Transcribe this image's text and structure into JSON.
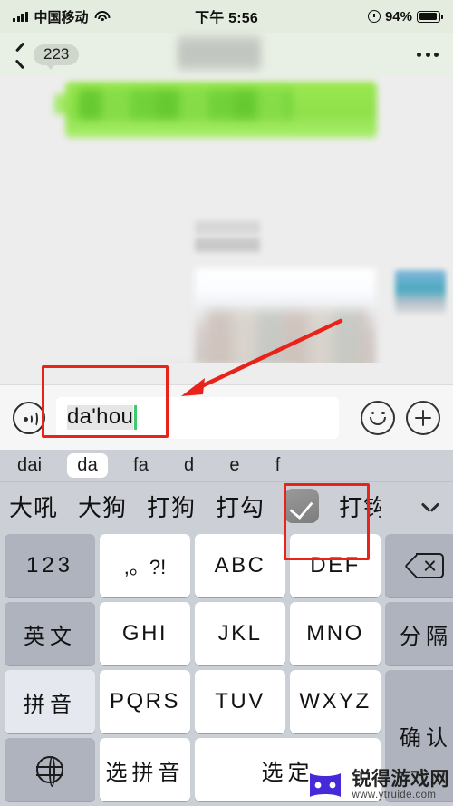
{
  "status_bar": {
    "signal_icon": "signal-bars-icon",
    "carrier": "中国移动",
    "wifi_icon": "wifi-icon",
    "time": "下午 5:56",
    "alarm_icon": "alarm-clock-icon",
    "battery_percent": "94%",
    "battery_icon": "battery-icon"
  },
  "nav_bar": {
    "back_icon": "back-chevron-icon",
    "unread_count": "223",
    "title": "",
    "more_icon": "more-dots-icon"
  },
  "chat": {
    "messages_blurred": true
  },
  "input_bar": {
    "voice_icon": "voice-input-icon",
    "composing_text": "da'hou",
    "placeholder": "",
    "emoji_icon": "smiley-face-icon",
    "plus_icon": "plus-circle-icon"
  },
  "ime": {
    "syllables": [
      {
        "label": "dai",
        "active": false
      },
      {
        "label": "da",
        "active": true
      },
      {
        "label": "fa",
        "active": false
      },
      {
        "label": "d",
        "active": false
      },
      {
        "label": "e",
        "active": false
      },
      {
        "label": "f",
        "active": false
      }
    ],
    "candidates": [
      {
        "label": "大吼",
        "type": "text"
      },
      {
        "label": "大狗",
        "type": "text"
      },
      {
        "label": "打狗",
        "type": "text"
      },
      {
        "label": "打勾",
        "type": "text"
      },
      {
        "label": "☑",
        "type": "emoji",
        "name": "check-box-emoji"
      },
      {
        "label": "打钩",
        "type": "text"
      }
    ],
    "expand_icon": "chevron-down-icon"
  },
  "keyboard": {
    "keys": [
      {
        "label": "123",
        "style": "fn",
        "name": "key-123"
      },
      {
        "label": ",。?!",
        "style": "punct",
        "name": "key-punctuation"
      },
      {
        "label": "ABC",
        "style": "letters",
        "name": "key-abc"
      },
      {
        "label": "DEF",
        "style": "letters",
        "name": "key-def"
      },
      {
        "label": "",
        "style": "fn",
        "name": "key-backspace",
        "icon": "backspace-icon"
      },
      {
        "label": "英文",
        "style": "fn",
        "name": "key-english"
      },
      {
        "label": "GHI",
        "style": "letters",
        "name": "key-ghi"
      },
      {
        "label": "JKL",
        "style": "letters",
        "name": "key-jkl"
      },
      {
        "label": "MNO",
        "style": "letters",
        "name": "key-mno"
      },
      {
        "label": "分隔",
        "style": "fn",
        "name": "key-separator"
      },
      {
        "label": "拼音",
        "style": "fn-light",
        "name": "key-pinyin"
      },
      {
        "label": "PQRS",
        "style": "letters",
        "name": "key-pqrs"
      },
      {
        "label": "TUV",
        "style": "letters",
        "name": "key-tuv"
      },
      {
        "label": "WXYZ",
        "style": "letters",
        "name": "key-wxyz"
      },
      {
        "label": "确认",
        "style": "fn",
        "name": "key-confirm"
      },
      {
        "label": "",
        "style": "fn",
        "name": "key-globe",
        "icon": "globe-icon"
      },
      {
        "label": "选拼音",
        "style": "letters",
        "name": "key-choose-pinyin"
      },
      {
        "label": "选定",
        "style": "letters",
        "name": "key-select"
      }
    ]
  },
  "annotations": {
    "input_box_highlight": true,
    "candidate_highlight": true,
    "arrow_color": "#e8241a"
  },
  "watermark": {
    "site_name": "锐得游戏网",
    "url": "www.ytruide.com"
  },
  "colors": {
    "wechat_green": "#95ec69",
    "annotation_red": "#e8241a",
    "keyboard_bg": "#cbcfd6",
    "key_white": "#ffffff",
    "key_gray": "#aeb3bd"
  }
}
